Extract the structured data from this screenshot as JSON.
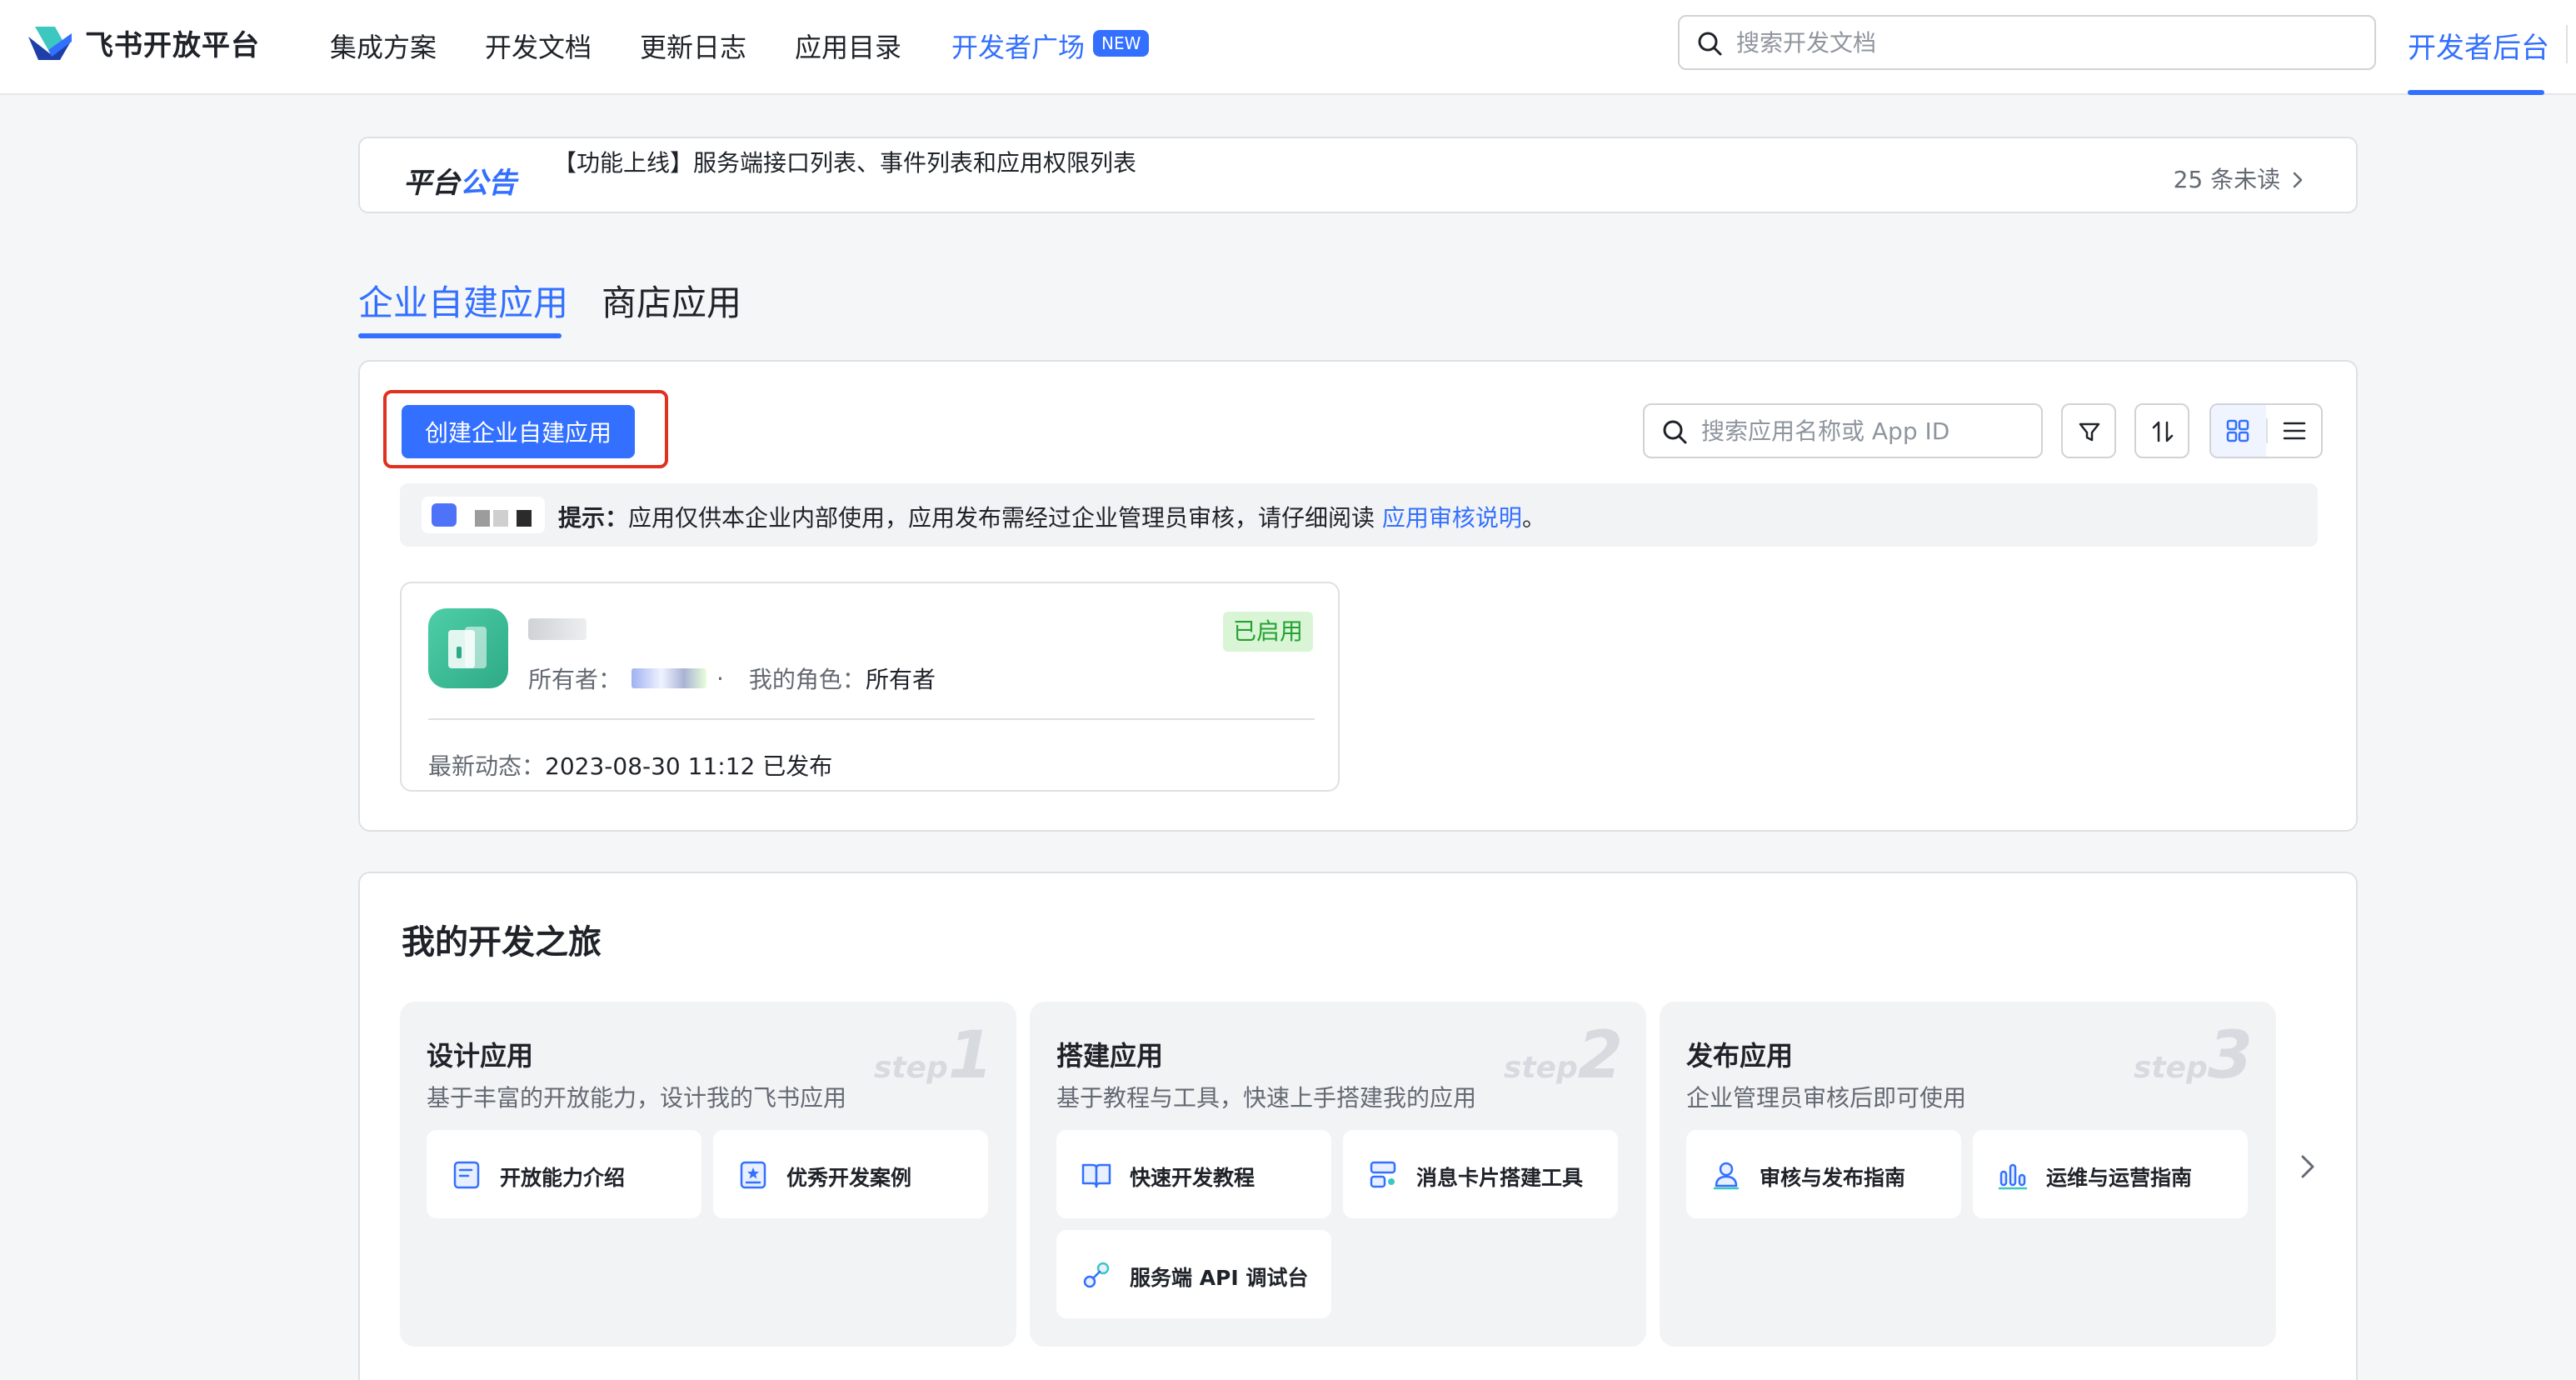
{
  "topnav": {
    "logo_text": "飞书开放平台",
    "items": [
      "集成方案",
      "开发文档",
      "更新日志",
      "应用目录",
      "开发者广场"
    ],
    "new_badge": "NEW",
    "search_placeholder": "搜索开发文档",
    "console_label": "开发者后台",
    "accent_color": "#3370ff"
  },
  "announcement": {
    "title_prefix": "平台",
    "title_suffix": "公告",
    "text": "【功能上线】服务端接口列表、事件列表和应用权限列表",
    "unread": "25 条未读",
    "unread_icon": "chevron-right-icon"
  },
  "tabs": [
    "企业自建应用",
    "商店应用"
  ],
  "apps_panel": {
    "create_button": "创建企业自建应用",
    "search_placeholder": "搜索应用名称或 App ID",
    "tools": [
      "filter-icon",
      "sort-icon",
      "grid-view-icon",
      "list-view-icon"
    ],
    "tip": {
      "prefix": "提示：",
      "text": "应用仅供本企业内部使用，应用发布需经过企业管理员审核，请仔细阅读 ",
      "link": "应用审核说明",
      "suffix": "。"
    },
    "app_card": {
      "owner_label": "所有者：",
      "dot": "·",
      "role_label": "我的角色：",
      "role_value": "所有者",
      "status": "已启用",
      "activity_label": "最新动态：",
      "activity_value": "2023-08-30 11:12  已发布"
    }
  },
  "journey": {
    "title": "我的开发之旅",
    "steps": [
      {
        "title": "设计应用",
        "desc": "基于丰富的开放能力，设计我的飞书应用",
        "watermark_word": "step",
        "watermark_num": "1",
        "items": [
          {
            "label": "开放能力介绍",
            "icon": "doc-icon"
          },
          {
            "label": "优秀开发案例",
            "icon": "case-icon"
          }
        ]
      },
      {
        "title": "搭建应用",
        "desc": "基于教程与工具，快速上手搭建我的应用",
        "watermark_word": "step",
        "watermark_num": "2",
        "items": [
          {
            "label": "快速开发教程",
            "icon": "book-icon"
          },
          {
            "label": "消息卡片搭建工具",
            "icon": "card-builder-icon"
          },
          {
            "label": "服务端 API 调试台",
            "icon": "api-debug-icon"
          }
        ]
      },
      {
        "title": "发布应用",
        "desc": "企业管理员审核后即可使用",
        "watermark_word": "step",
        "watermark_num": "3",
        "items": [
          {
            "label": "审核与发布指南",
            "icon": "review-icon"
          },
          {
            "label": "运维与运营指南",
            "icon": "ops-chart-icon"
          }
        ]
      }
    ],
    "next_icon": "chevron-right-icon"
  }
}
